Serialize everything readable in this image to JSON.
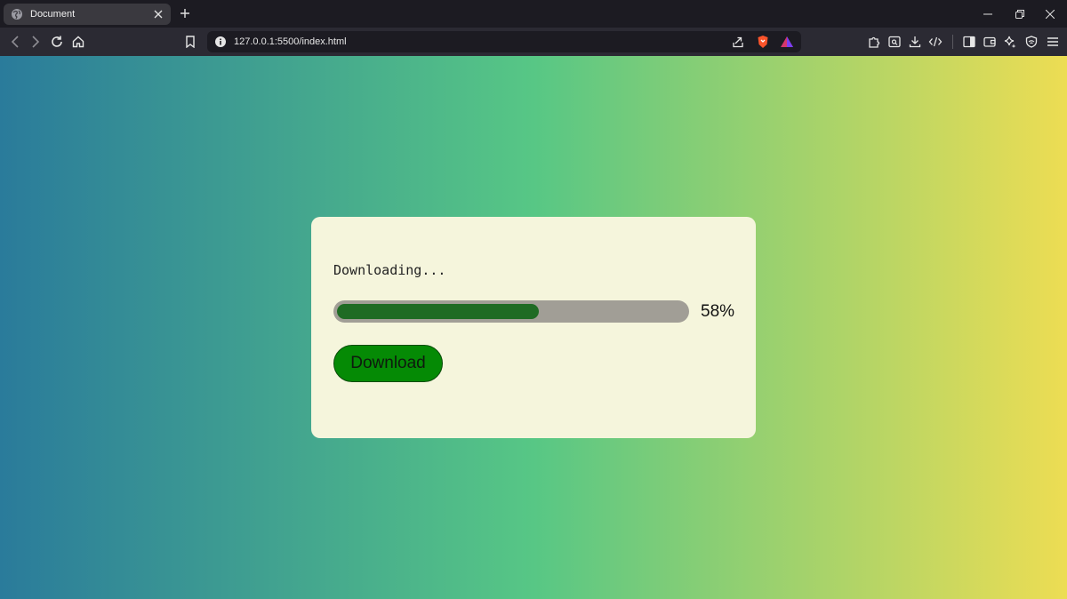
{
  "browser": {
    "tab": {
      "title": "Document",
      "favicon": "globe-icon"
    },
    "url": "127.0.0.1:5500/index.html",
    "icons": {
      "back": "back-arrow-icon",
      "forward": "forward-arrow-icon",
      "reload": "reload-icon",
      "home": "home-icon",
      "bookmark": "bookmark-icon",
      "share": "share-icon",
      "shields": "brave-shield-icon",
      "rewards": "brave-rewards-icon",
      "extensions": "puzzle-icon",
      "tab_search": "tab-search-icon",
      "downloads": "download-icon",
      "devtools": "code-icon",
      "sidebar": "sidebar-icon",
      "wallet": "wallet-icon",
      "leo": "sparkle-icon",
      "vpn": "vpn-shield-icon",
      "menu": "hamburger-menu-icon"
    }
  },
  "page": {
    "background_gradient": [
      "#2a7b9b",
      "#57c785",
      "#eddd53"
    ],
    "card": {
      "status_text": "Downloading...",
      "progress_fraction": 0.58,
      "percent_label": "58%",
      "button_label": "Download",
      "colors": {
        "card_bg": "#f5f5dc",
        "track": "#a19e96",
        "fill": "#1f6b24",
        "button": "#058a05"
      }
    }
  }
}
